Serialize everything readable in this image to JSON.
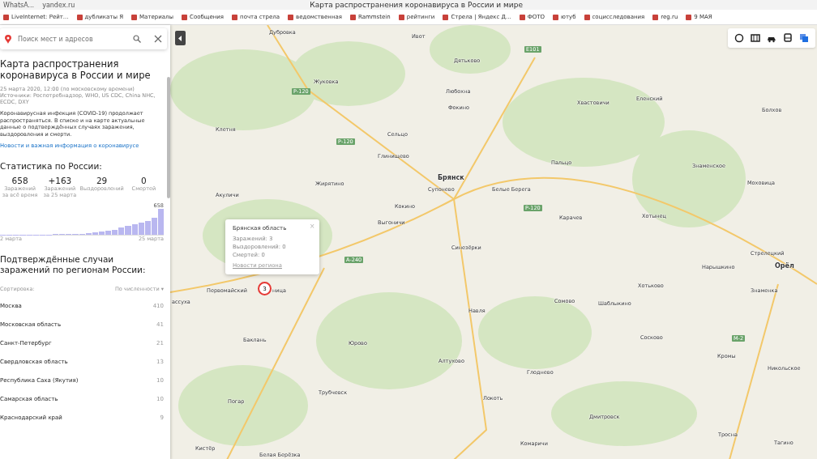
{
  "browser": {
    "tab_title": "WhatsA...",
    "address": "yandex.ru",
    "page_title": "Карта распространения коронавируса в России и мире"
  },
  "bookmarks": [
    "LiveInternet: Рейт...",
    "дубликаты Я",
    "Материалы",
    "Сообщения",
    "почта стрела",
    "ведомственная",
    "Rammstein",
    "рейтинги",
    "Стрела | Яндекс Д...",
    "ФОТО",
    "ютуб",
    "социсследования",
    "reg.ru",
    "9 МАЯ"
  ],
  "search": {
    "placeholder": "Поиск мест и адресов"
  },
  "article": {
    "title": "Карта распространения коронавируса в России и мире",
    "meta": "25 марта 2020, 12:00 (по московскому времени)\nИсточники: Роспотребнадзор, WHO, US CDC, China NHC, ECDC, DXY",
    "body": "Коронавирусная инфекция (COVID-19) продолжает распространяться. В списке и на карте актуальные данные о подтверждённых случаях заражения, выздоровления и смерти.",
    "link": "Новости и важная информация о коронавирусе"
  },
  "stats": {
    "title": "Статистика по России:",
    "items": [
      {
        "value": "658",
        "label": "Заражений\nза всё время"
      },
      {
        "value": "+163",
        "label": "Заражений\nза 25 марта"
      },
      {
        "value": "29",
        "label": "Выздоровлений"
      },
      {
        "value": "0",
        "label": "Смертей"
      }
    ],
    "chart_max": "658",
    "chart_start": "2 марта",
    "chart_end": "25 марта"
  },
  "regions": {
    "title": "Подтверждённые случаи заражений по регионам России:",
    "sort_label": "Сортировка:",
    "sort_value": "По численности ▾",
    "rows": [
      {
        "name": "Москва",
        "count": "410"
      },
      {
        "name": "Московская область",
        "count": "41"
      },
      {
        "name": "Санкт-Петербург",
        "count": "21"
      },
      {
        "name": "Свердловская область",
        "count": "13"
      },
      {
        "name": "Республика Саха (Якутия)",
        "count": "10"
      },
      {
        "name": "Самарская область",
        "count": "10"
      },
      {
        "name": "Краснодарский край",
        "count": "9"
      }
    ]
  },
  "popup": {
    "title": "Брянская область",
    "lines": [
      "Заражений: 3",
      "Выздоровлений: 0",
      "Смертей: 0"
    ],
    "link": "Новости региона",
    "close": "×"
  },
  "marker": {
    "count": "3"
  },
  "map_labels": [
    {
      "text": "Дубровка",
      "kind": "town"
    },
    {
      "text": "Ивот",
      "kind": "town"
    },
    {
      "text": "Дятьково",
      "kind": "town"
    },
    {
      "text": "Жуковка",
      "kind": "town"
    },
    {
      "text": "Любохна",
      "kind": "town"
    },
    {
      "text": "Хвастовичи",
      "kind": "town"
    },
    {
      "text": "Еленский",
      "kind": "town"
    },
    {
      "text": "Фокино",
      "kind": "town"
    },
    {
      "text": "Болхов",
      "kind": "town"
    },
    {
      "text": "Клетня",
      "kind": "town"
    },
    {
      "text": "Сельцо",
      "kind": "town"
    },
    {
      "text": "Глинищево",
      "kind": "town"
    },
    {
      "text": "Пальцо",
      "kind": "town"
    },
    {
      "text": "Брянск",
      "kind": "city"
    },
    {
      "text": "Знаменское",
      "kind": "town"
    },
    {
      "text": "Моховица",
      "kind": "town"
    },
    {
      "text": "Жирятино",
      "kind": "town"
    },
    {
      "text": "Супонево",
      "kind": "town"
    },
    {
      "text": "Белые Берега",
      "kind": "town"
    },
    {
      "text": "Акуличи",
      "kind": "town"
    },
    {
      "text": "Кокино",
      "kind": "town"
    },
    {
      "text": "Выгоничи",
      "kind": "town"
    },
    {
      "text": "Карачев",
      "kind": "town"
    },
    {
      "text": "Хотынец",
      "kind": "town"
    },
    {
      "text": "Синезёрки",
      "kind": "town"
    },
    {
      "text": "Стрелецкий",
      "kind": "town"
    },
    {
      "text": "Нарышкино",
      "kind": "town"
    },
    {
      "text": "Орёл",
      "kind": "city"
    },
    {
      "text": "Первомайский",
      "kind": "town"
    },
    {
      "text": "ница",
      "kind": "town"
    },
    {
      "text": "Хотьково",
      "kind": "town"
    },
    {
      "text": "Знаменка",
      "kind": "town"
    },
    {
      "text": "ассуха",
      "kind": "town"
    },
    {
      "text": "Сомово",
      "kind": "town"
    },
    {
      "text": "Шаблыкино",
      "kind": "town"
    },
    {
      "text": "Навля",
      "kind": "town"
    },
    {
      "text": "Баклань",
      "kind": "town"
    },
    {
      "text": "Юрово",
      "kind": "town"
    },
    {
      "text": "Сосково",
      "kind": "town"
    },
    {
      "text": "Кромы",
      "kind": "town"
    },
    {
      "text": "Алтухово",
      "kind": "town"
    },
    {
      "text": "Глоднево",
      "kind": "town"
    },
    {
      "text": "Никольское",
      "kind": "town"
    },
    {
      "text": "Трубчевск",
      "kind": "town"
    },
    {
      "text": "Погар",
      "kind": "town"
    },
    {
      "text": "Локоть",
      "kind": "town"
    },
    {
      "text": "Дмитровск",
      "kind": "town"
    },
    {
      "text": "Кистёр",
      "kind": "town"
    },
    {
      "text": "Комаричи",
      "kind": "town"
    },
    {
      "text": "Белая Берёзка",
      "kind": "town"
    },
    {
      "text": "Тросна",
      "kind": "town"
    },
    {
      "text": "Тагино",
      "kind": "town"
    },
    {
      "text": "Р-120",
      "kind": "road"
    },
    {
      "text": "Р-120",
      "kind": "road"
    },
    {
      "text": "Р-120",
      "kind": "road"
    },
    {
      "text": "А-240",
      "kind": "road"
    },
    {
      "text": "М-2",
      "kind": "road"
    },
    {
      "text": "Е101",
      "kind": "road"
    }
  ]
}
